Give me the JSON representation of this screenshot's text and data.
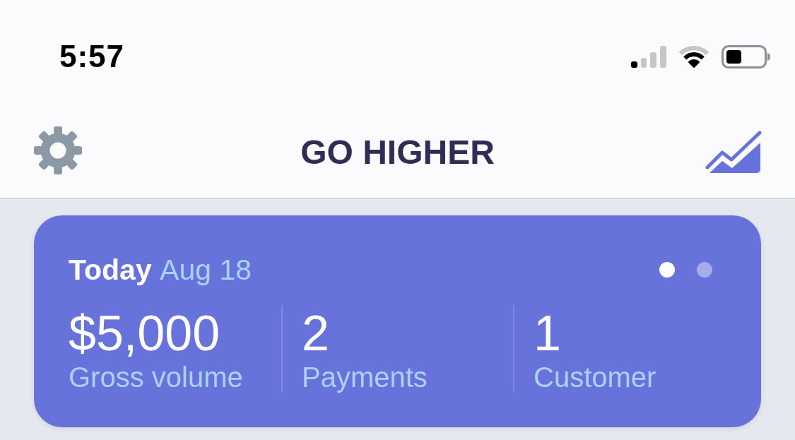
{
  "status_bar": {
    "time": "5:57"
  },
  "nav_bar": {
    "title": "GO HIGHER"
  },
  "summary_card": {
    "period": "Today",
    "date": "Aug 18",
    "pages": [
      {
        "selected": true
      },
      {
        "selected": false
      }
    ],
    "stats": [
      {
        "value": "$5,000",
        "label": "Gross volume"
      },
      {
        "value": "2",
        "label": "Payments"
      },
      {
        "value": "1",
        "label": "Customer"
      }
    ]
  }
}
